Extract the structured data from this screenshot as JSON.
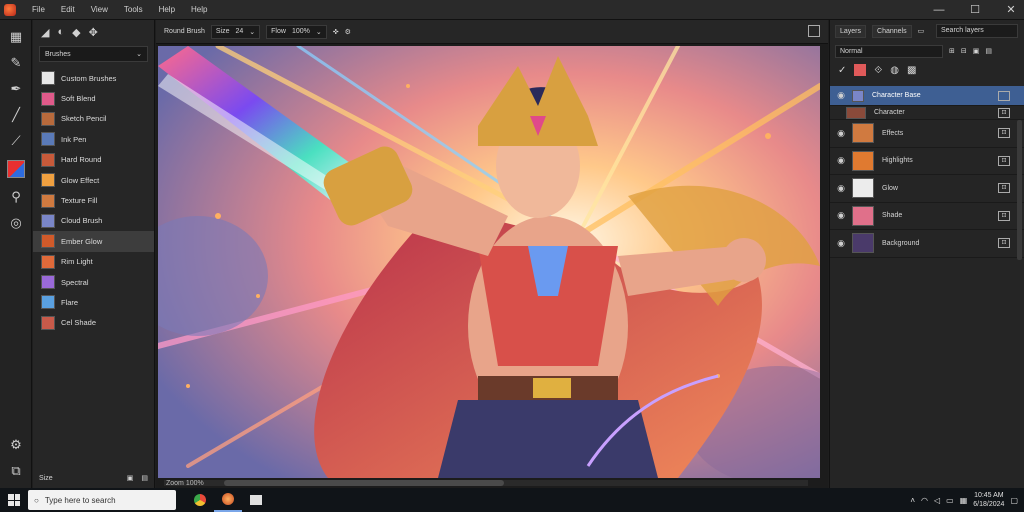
{
  "menu": [
    "File",
    "Edit",
    "View",
    "Tools",
    "Help",
    "Help"
  ],
  "window_controls": {
    "minimize": "—",
    "maximize": "☐",
    "close": "✕"
  },
  "tools": [
    "layers-icon",
    "brush-icon",
    "pen-icon",
    "pencil-icon",
    "color-swatch",
    "dropper-icon",
    "smudge-icon"
  ],
  "brush_panel": {
    "header_icons": [
      "brush-icon",
      "airbrush-icon",
      "ink-icon",
      "marker-icon"
    ],
    "category": "Brushes",
    "items": [
      {
        "label": "Custom Brushes",
        "thumb": "#e8e8e8"
      },
      {
        "label": "Soft Blend",
        "thumb": "#e05a8a"
      },
      {
        "label": "Sketch Pencil",
        "thumb": "#b86a3c"
      },
      {
        "label": "Ink Pen",
        "thumb": "#5a7ab8"
      },
      {
        "label": "Hard Round",
        "thumb": "#c85a3a"
      },
      {
        "label": "Glow Effect",
        "thumb": "#f0a040"
      },
      {
        "label": "Texture Fill",
        "thumb": "#d07a40"
      },
      {
        "label": "Cloud Brush",
        "thumb": "#7a86c8"
      },
      {
        "label": "Ember Glow",
        "thumb": "#d05a2a"
      },
      {
        "label": "Rim Light",
        "thumb": "#e06a3a"
      },
      {
        "label": "Spectral",
        "thumb": "#9a6ad8"
      },
      {
        "label": "Flare",
        "thumb": "#5aa0e0"
      },
      {
        "label": "Cel Shade",
        "thumb": "#c85a4a"
      }
    ],
    "selected_index": 8,
    "footer_label": "Size"
  },
  "options_bar": {
    "brush_name": "Round Brush",
    "size_label": "Size",
    "size_value": "24",
    "opacity_label": "Flow",
    "opacity_value": "100%"
  },
  "canvas": {
    "status_text": "Zoom 100%"
  },
  "right_panel": {
    "tabs": [
      "Layers",
      "Channels"
    ],
    "search_placeholder": "Search layers",
    "blend_mode": "Normal",
    "layers": [
      {
        "name": "Character Base",
        "active": true,
        "visible": true,
        "thumb": "#7a86c8",
        "sub": false
      },
      {
        "name": "Character",
        "active": false,
        "visible": false,
        "thumb": "#8a4a3a",
        "sub": true
      },
      {
        "name": "Effects",
        "active": false,
        "visible": true,
        "thumb": "#d07a40",
        "sub": false
      },
      {
        "name": "Highlights",
        "active": false,
        "visible": true,
        "thumb": "#e07a30",
        "sub": false
      },
      {
        "name": "Glow",
        "active": false,
        "visible": true,
        "thumb": "#ececec",
        "sub": false
      },
      {
        "name": "Shade",
        "active": false,
        "visible": true,
        "thumb": "#e0708a",
        "sub": false
      },
      {
        "name": "Background",
        "active": false,
        "visible": true,
        "thumb": "#4a3a6a",
        "sub": false
      }
    ]
  },
  "taskbar": {
    "search_placeholder": "Type here to search",
    "clock_time": "10:45 AM",
    "clock_date": "6/18/2024"
  }
}
